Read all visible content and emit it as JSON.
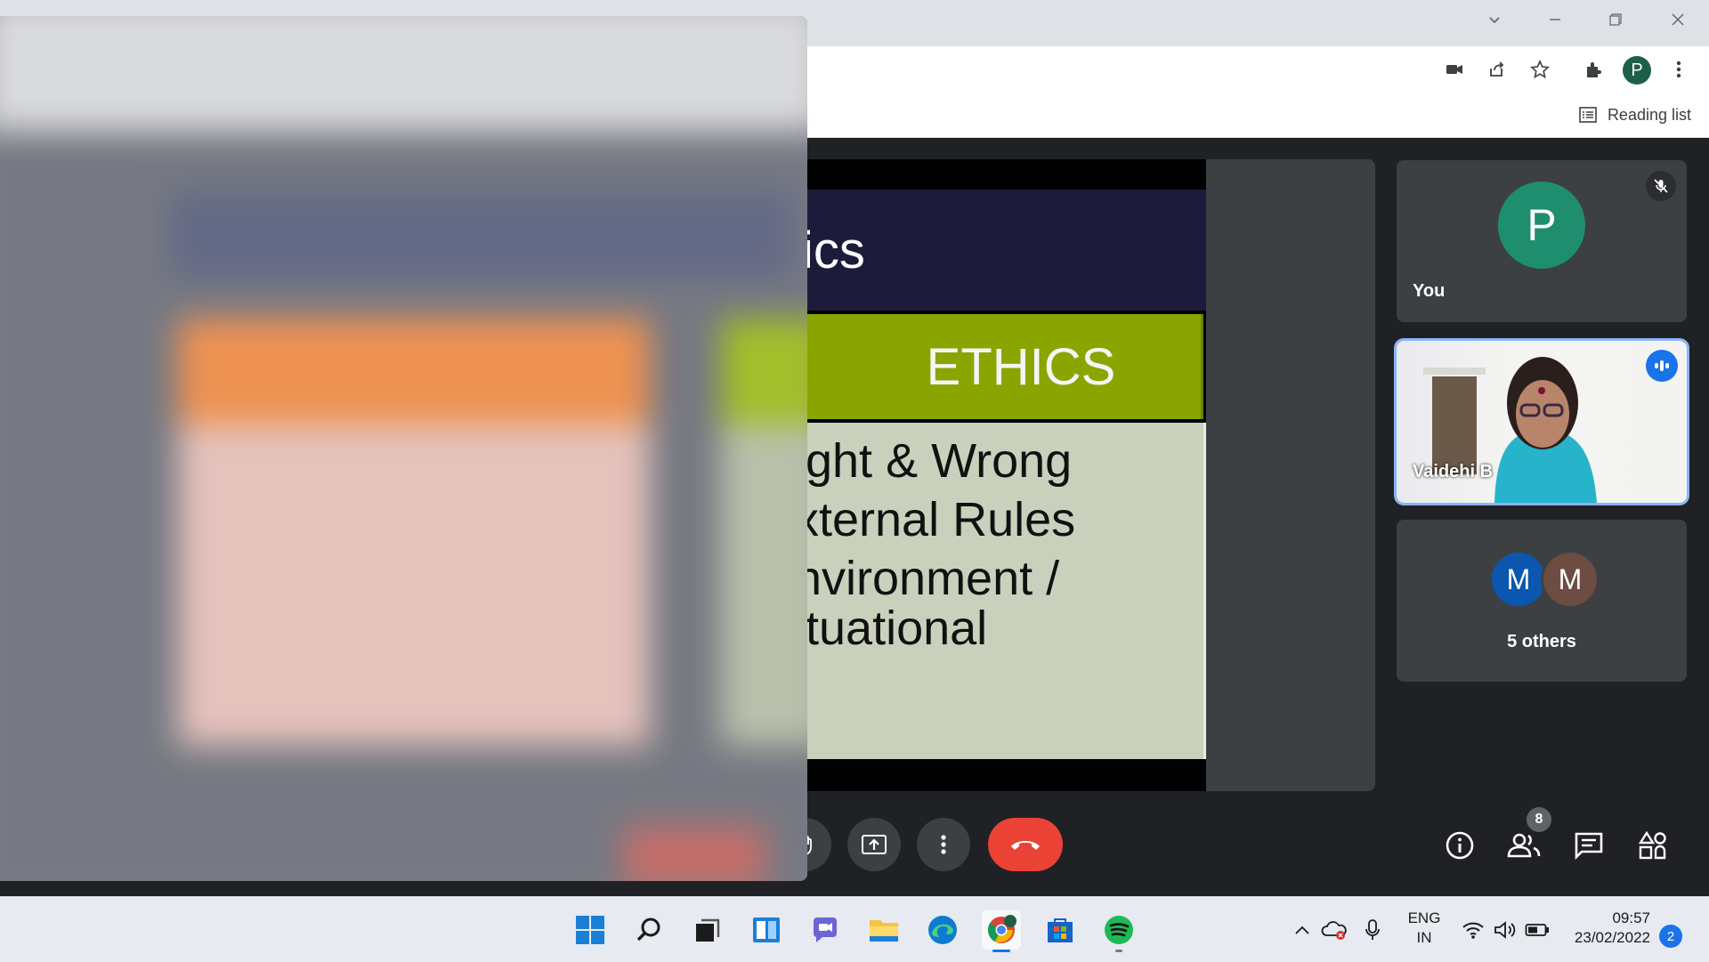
{
  "browser": {
    "profile_initial": "P",
    "bookmarks": {
      "reading_list_label": "Reading list"
    }
  },
  "slide": {
    "title_fragment": "ics",
    "heading": "ETHICS",
    "bullets": [
      "ight & Wrong",
      "xternal Rules",
      "nvironment /",
      "ituational"
    ]
  },
  "participants": {
    "you": {
      "initial": "P",
      "name": "You",
      "avatar_color": "#1e8e6e"
    },
    "speaker": {
      "name": "Vaidehi B"
    },
    "others": {
      "avatars": [
        {
          "initial": "M",
          "color": "#0b57b0"
        },
        {
          "initial": "M",
          "color": "#6d4c41"
        }
      ],
      "label": "5 others"
    }
  },
  "controls": {
    "participants_count": "8",
    "end_call_color": "#ea4335"
  },
  "taskbar": {
    "language": "ENG",
    "region": "IN",
    "time": "09:57",
    "date": "23/02/2022",
    "notifications": "2"
  }
}
